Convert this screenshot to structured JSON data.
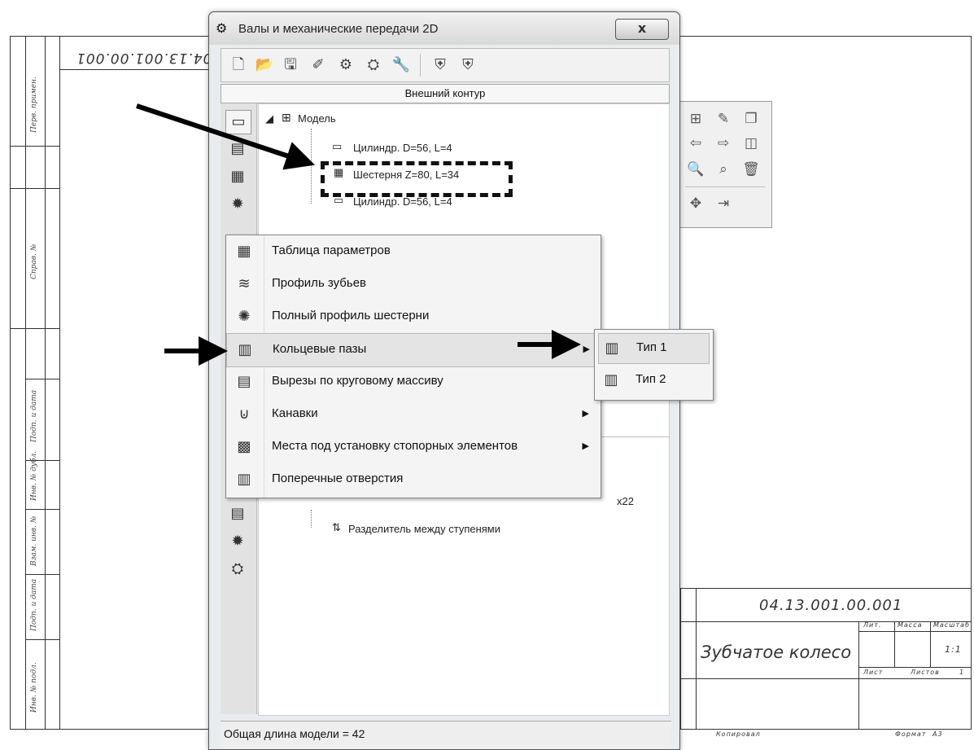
{
  "window": {
    "title": "Валы и механические передачи 2D",
    "close_label": "x",
    "panel_header": "Внешний контур",
    "status": "Общая длина модели = 42"
  },
  "tree": {
    "root": "Модель",
    "nodes": [
      "Цилиндр. D=56, L=4",
      "Шестерня Z=80, L=34",
      "Цилиндр. D=56, L=4"
    ],
    "lower_partial": "x22",
    "lower_node": "Разделитель между ступенями"
  },
  "menu": {
    "items": [
      {
        "label": "Таблица параметров",
        "icon": "table-icon"
      },
      {
        "label": "Профиль зубьев",
        "icon": "teeth-profile-icon"
      },
      {
        "label": "Полный профиль шестерни",
        "icon": "gear-profile-icon"
      },
      {
        "label": "Кольцевые пазы",
        "icon": "ring-groove-icon"
      },
      {
        "label": "Вырезы по круговому массиву",
        "icon": "circular-cut-icon"
      },
      {
        "label": "Канавки",
        "icon": "groove-icon"
      },
      {
        "label": "Места под установку стопорных элементов",
        "icon": "lock-element-icon"
      },
      {
        "label": "Поперечные отверстия",
        "icon": "cross-hole-icon"
      }
    ]
  },
  "submenu": {
    "items": [
      {
        "label": "Тип 1"
      },
      {
        "label": "Тип 2"
      }
    ]
  },
  "drawing": {
    "designation": "04.13.001.00.001",
    "designation_mirrored": "04.13.001.00.001",
    "part_name": "Зубчатое колесо",
    "scale": "1:1",
    "sheet": "1",
    "lit_label": "Лит.",
    "mass_label": "Масса",
    "scale_label": "Масштаб",
    "sheet_label": "Лист",
    "sheets_label": "Листов",
    "copied_label": "Копировал",
    "format_label": "Формат",
    "format": "A3",
    "side_labels": [
      "Перв. примен.",
      "Справ. №",
      "Подп. и дата",
      "Инв. № дубл.",
      "Взам. инв. №",
      "Подп. и дата",
      "Инв. № подл."
    ]
  }
}
